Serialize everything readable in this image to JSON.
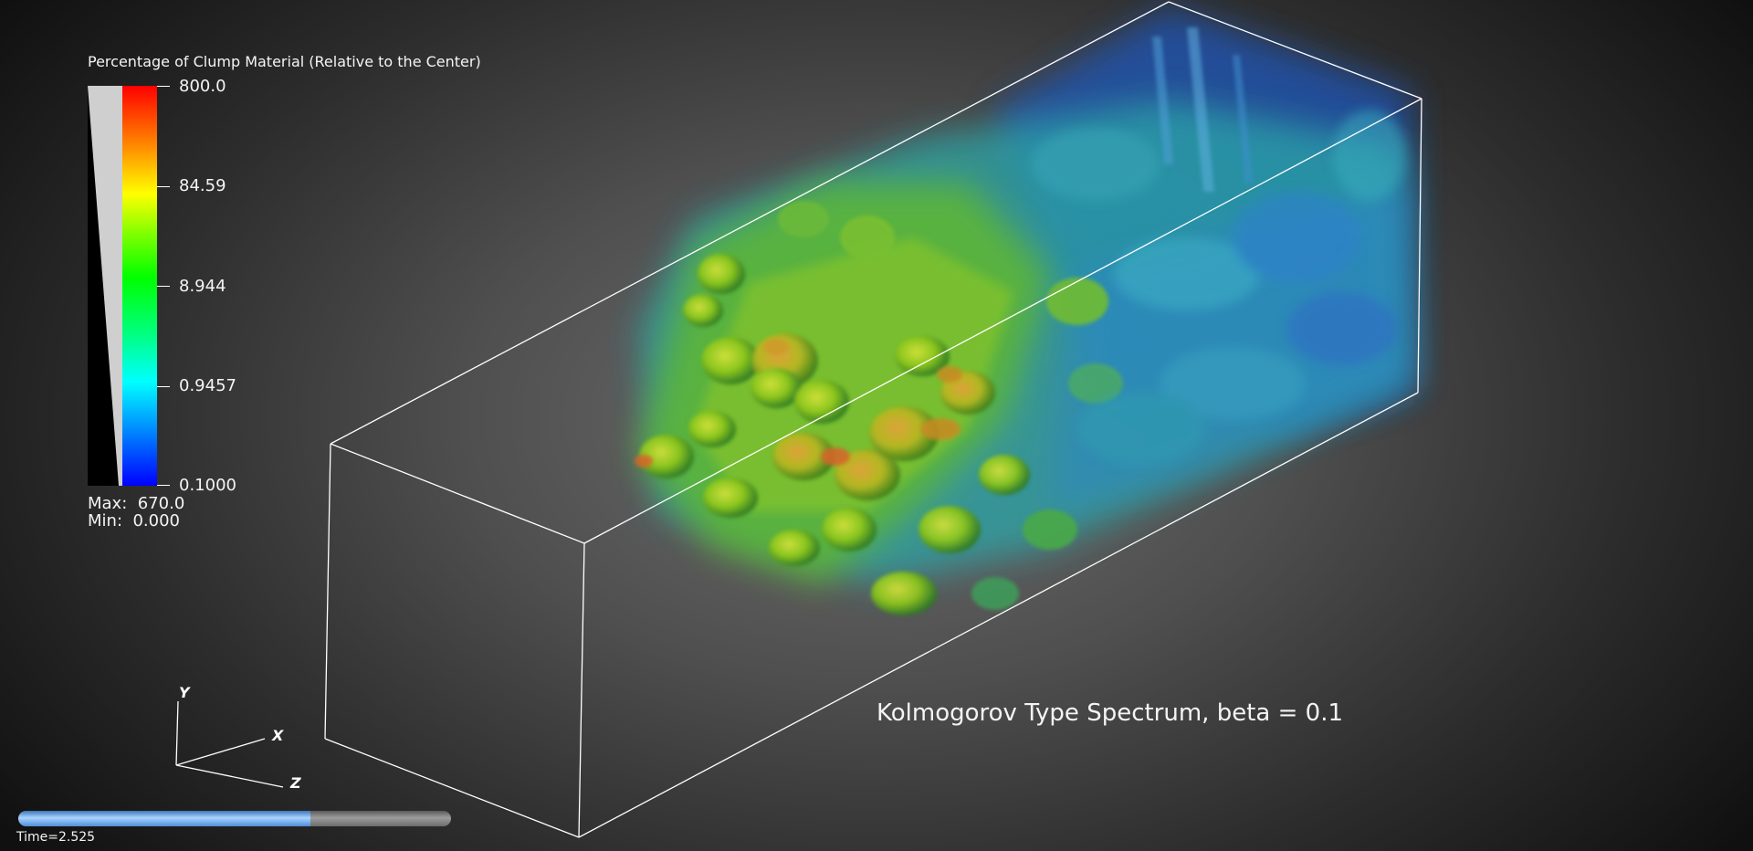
{
  "legend": {
    "title": "Percentage of Clump Material (Relative to the Center)",
    "ticks": [
      "800.0",
      "84.59",
      "8.944",
      "0.9457",
      "0.1000"
    ],
    "max_label": "Max:",
    "max_value": "670.0",
    "min_label": "Min:",
    "min_value": "0.000"
  },
  "annotation": "Kolmogorov Type Spectrum, beta = 0.1",
  "axes": {
    "x": "X",
    "y": "Y",
    "z": "Z"
  },
  "time": {
    "label": "Time=2.525",
    "progress": 0.675
  },
  "colors": {
    "background_center": "#6e6e6e",
    "background_edge": "#101010",
    "bounding_box": "#ffffff",
    "colormap": [
      "#0000ff",
      "#00ffff",
      "#00ff00",
      "#ffff00",
      "#ff0000"
    ],
    "progress_fill": "#8cc3ff",
    "progress_track": "#8c8c8c"
  }
}
